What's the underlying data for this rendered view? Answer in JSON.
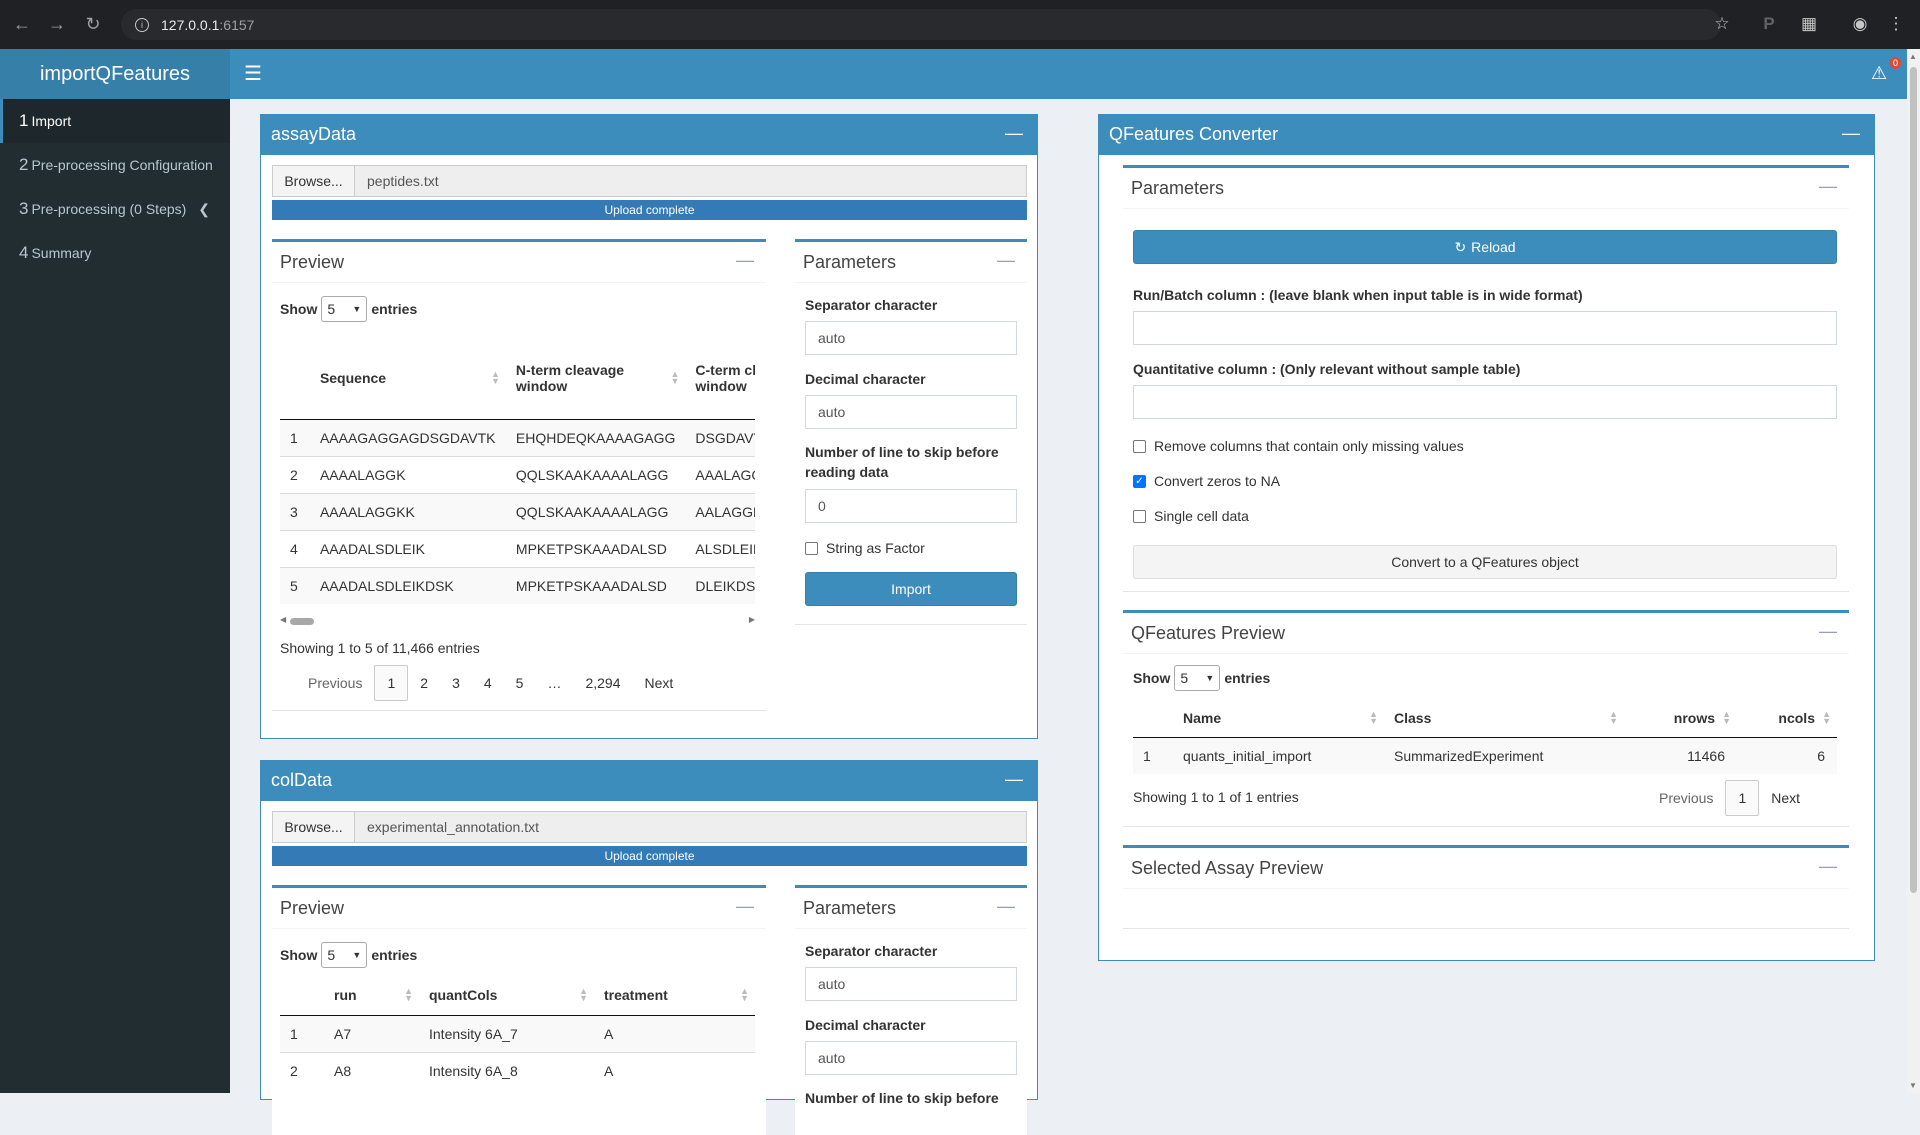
{
  "browser": {
    "url_host": "127.0.0.1",
    "url_port": ":6157"
  },
  "app": {
    "title": "importQFeatures",
    "notification_count": "0"
  },
  "sidebar": {
    "items": [
      {
        "num": "1",
        "label": "Import"
      },
      {
        "num": "2",
        "label": "Pre-processing Configuration"
      },
      {
        "num": "3",
        "label": "Pre-processing (0 Steps)"
      },
      {
        "num": "4",
        "label": "Summary"
      }
    ]
  },
  "assay": {
    "title": "assayData",
    "browse_label": "Browse...",
    "file_name": "peptides.txt",
    "progress": 1.0,
    "progress_label": "Upload complete",
    "preview": {
      "title": "Preview",
      "show": "Show",
      "entries_value": "5",
      "entries": "entries",
      "columns": [
        "",
        "Sequence",
        "N-term cleavage window",
        "C-term cleavage window"
      ],
      "col3_visible": "C-term cl",
      "col3_line2": "window",
      "col2_line1": "N-term cleavage",
      "col2_line2": "window",
      "rows": [
        [
          "1",
          "AAAAGAGGAGDSGDAVTK",
          "EHQHDEQKAAAAGAGG",
          "DSGDAVT"
        ],
        [
          "2",
          "AAAALAGGK",
          "QQLSKAAKAAAALAGG",
          "AAALAGG"
        ],
        [
          "3",
          "AAAALAGGKK",
          "QQLSKAAKAAAALAGG",
          "AALAGGK"
        ],
        [
          "4",
          "AAADALSDLEIK",
          "MPKETPSKAAADALSD",
          "ALSDLEIK"
        ],
        [
          "5",
          "AAADALSDLEIKDSK",
          "MPKETPSKAAADALSD",
          "DLEIKDSK"
        ]
      ],
      "info": "Showing 1 to 5 of 11,466 entries",
      "pager": [
        "Previous",
        "1",
        "2",
        "3",
        "4",
        "5",
        "…",
        "2,294",
        "Next"
      ]
    },
    "params": {
      "title": "Parameters",
      "sep_label": "Separator character",
      "sep_value": "auto",
      "dec_label": "Decimal character",
      "dec_value": "auto",
      "skip_label_1": "Number of line to skip before",
      "skip_label_2": "reading data",
      "skip_value": "0",
      "string_factor": "String as Factor",
      "import_btn": "Import"
    }
  },
  "coldata": {
    "title": "colData",
    "browse_label": "Browse...",
    "file_name": "experimental_annotation.txt",
    "progress": 1.0,
    "progress_label": "Upload complete",
    "preview": {
      "title": "Preview",
      "show": "Show",
      "entries_value": "5",
      "entries": "entries",
      "columns": [
        "",
        "run",
        "quantCols",
        "treatment"
      ],
      "rows": [
        [
          "1",
          "A7",
          "Intensity 6A_7",
          "A"
        ],
        [
          "2",
          "A8",
          "Intensity 6A_8",
          "A"
        ]
      ]
    },
    "params": {
      "title": "Parameters",
      "sep_label": "Separator character",
      "sep_value": "auto",
      "dec_label": "Decimal character",
      "dec_value": "auto",
      "skip_label_1": "Number of line to skip before"
    }
  },
  "converter": {
    "title": "QFeatures Converter",
    "params": {
      "title": "Parameters",
      "reload_btn": "Reload",
      "run_label": "Run/Batch column : (leave blank when input table is in wide format)",
      "run_value": "",
      "quant_label": "Quantitative column : (Only relevant without sample table)",
      "quant_value": "",
      "remove_missing": "Remove columns that contain only missing values",
      "remove_missing_checked": false,
      "zeros_na": "Convert zeros to NA",
      "zeros_na_checked": true,
      "single_cell": "Single cell data",
      "single_cell_checked": false,
      "convert_btn": "Convert to a QFeatures object"
    },
    "preview": {
      "title": "QFeatures Preview",
      "show": "Show",
      "entries_value": "5",
      "entries": "entries",
      "columns": [
        "",
        "Name",
        "Class",
        "nrows",
        "ncols"
      ],
      "rows": [
        [
          "1",
          "quants_initial_import",
          "SummarizedExperiment",
          "11466",
          "6"
        ]
      ],
      "info": "Showing 1 to 1 of 1 entries",
      "pager": [
        "Previous",
        "1",
        "Next"
      ]
    },
    "assay_preview": {
      "title": "Selected Assay Preview"
    }
  }
}
